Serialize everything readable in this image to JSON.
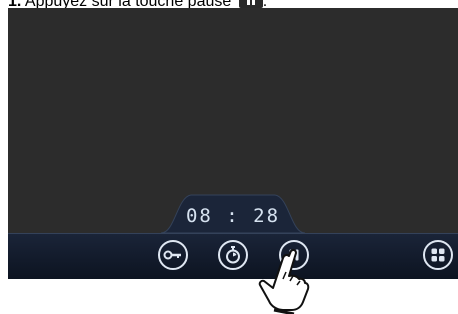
{
  "instruction": {
    "step": "1.",
    "text": " Appuyez sur la touche pause",
    "trailing": ".",
    "icon": "pause-key-glyph"
  },
  "display": {
    "timer": "08 : 28"
  },
  "controls": {
    "buttons": [
      {
        "name": "key-lock-button",
        "icon": "key-icon"
      },
      {
        "name": "timer-button",
        "icon": "stopwatch-icon"
      },
      {
        "name": "pause-button",
        "icon": "pause-icon"
      },
      {
        "name": "menu-button",
        "icon": "grid-icon"
      }
    ]
  },
  "colors": {
    "screen": "#2c2c2c",
    "bar": "#101a2c",
    "icon": "#dfe7f2",
    "timer_text": "#d6e2f0"
  }
}
